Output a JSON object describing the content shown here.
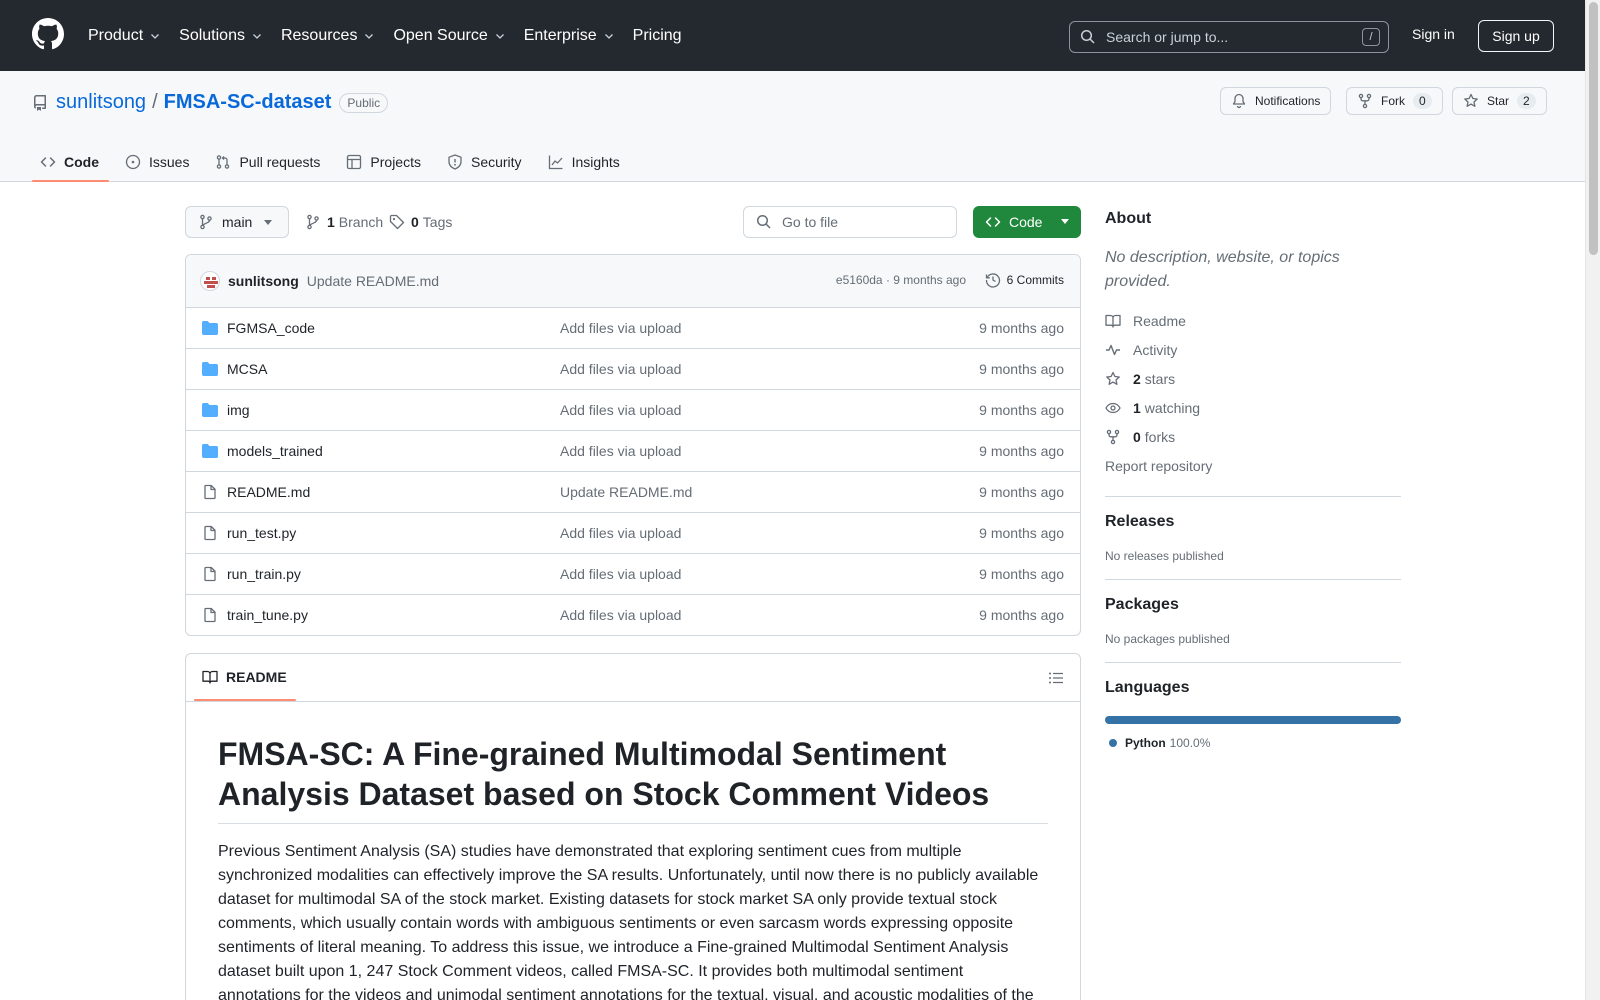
{
  "topnav": {
    "menu": [
      {
        "label": "Product",
        "has_dropdown": true
      },
      {
        "label": "Solutions",
        "has_dropdown": true
      },
      {
        "label": "Resources",
        "has_dropdown": true
      },
      {
        "label": "Open Source",
        "has_dropdown": true
      },
      {
        "label": "Enterprise",
        "has_dropdown": true
      },
      {
        "label": "Pricing",
        "has_dropdown": false
      }
    ],
    "search_placeholder": "Search or jump to...",
    "search_shortcut": "/",
    "signin": "Sign in",
    "signup": "Sign up"
  },
  "repo": {
    "owner": "sunlitsong",
    "separator": "/",
    "name": "FMSA-SC-dataset",
    "visibility": "Public",
    "notifications_label": "Notifications",
    "fork_label": "Fork",
    "fork_count": "0",
    "star_label": "Star",
    "star_count": "2"
  },
  "tabs": [
    {
      "label": "Code",
      "icon": "code-icon",
      "active": true
    },
    {
      "label": "Issues",
      "icon": "issue-icon",
      "active": false
    },
    {
      "label": "Pull requests",
      "icon": "pull-request-icon",
      "active": false
    },
    {
      "label": "Projects",
      "icon": "table-icon",
      "active": false
    },
    {
      "label": "Security",
      "icon": "shield-icon",
      "active": false
    },
    {
      "label": "Insights",
      "icon": "graph-icon",
      "active": false
    }
  ],
  "toolbar": {
    "branch": "main",
    "branch_count": "1",
    "branch_label": "Branch",
    "tag_count": "0",
    "tag_label": "Tags",
    "goto_placeholder": "Go to file",
    "code_button": "Code"
  },
  "latest_commit": {
    "author": "sunlitsong",
    "message": "Update README.md",
    "meta": "e5160da · 9 months ago",
    "commits_label": "6 Commits"
  },
  "files": [
    {
      "type": "folder",
      "name": "FGMSA_code",
      "message": "Add files via upload",
      "age": "9 months ago"
    },
    {
      "type": "folder",
      "name": "MCSA",
      "message": "Add files via upload",
      "age": "9 months ago"
    },
    {
      "type": "folder",
      "name": "img",
      "message": "Add files via upload",
      "age": "9 months ago"
    },
    {
      "type": "folder",
      "name": "models_trained",
      "message": "Add files via upload",
      "age": "9 months ago"
    },
    {
      "type": "file",
      "name": "README.md",
      "message": "Update README.md",
      "age": "9 months ago"
    },
    {
      "type": "file",
      "name": "run_test.py",
      "message": "Add files via upload",
      "age": "9 months ago"
    },
    {
      "type": "file",
      "name": "run_train.py",
      "message": "Add files via upload",
      "age": "9 months ago"
    },
    {
      "type": "file",
      "name": "train_tune.py",
      "message": "Add files via upload",
      "age": "9 months ago"
    }
  ],
  "readme": {
    "tab_label": "README",
    "title": "FMSA-SC: A Fine-grained Multimodal Sentiment Analysis Dataset based on Stock Comment Videos",
    "paragraph": "Previous Sentiment Analysis (SA) studies have demonstrated that exploring sentiment cues from multiple synchronized modalities can effectively improve the SA results. Unfortunately, until now there is no publicly available dataset for multimodal SA of the stock market. Existing datasets for stock market SA only provide textual stock comments, which usually contain words with ambiguous sentiments or even sarcasm words expressing opposite sentiments of literal meaning. To address this issue, we introduce a Fine-grained Multimodal Sentiment Analysis dataset built upon 1, 247 Stock Comment videos, called FMSA-SC. It provides both multimodal sentiment annotations for the videos and unimodal sentiment annotations for the textual, visual, and acoustic modalities of the"
  },
  "sidebar": {
    "about_title": "About",
    "about_desc": "No description, website, or topics provided.",
    "items": [
      {
        "icon": "book-icon",
        "count": "",
        "label": "Readme"
      },
      {
        "icon": "pulse-icon",
        "count": "",
        "label": "Activity"
      },
      {
        "icon": "star-icon",
        "count": "2",
        "label": "stars"
      },
      {
        "icon": "eye-icon",
        "count": "1",
        "label": "watching"
      },
      {
        "icon": "fork-icon",
        "count": "0",
        "label": "forks"
      }
    ],
    "report": "Report repository",
    "releases_title": "Releases",
    "releases_text": "No releases published",
    "packages_title": "Packages",
    "packages_text": "No packages published",
    "languages_title": "Languages",
    "language": {
      "name": "Python",
      "percent": "100.0%",
      "color": "#3572A5"
    }
  },
  "colors": {
    "header_bg": "#24292f",
    "link": "#0969da",
    "primary_button": "#1f883d",
    "active_tab_underline": "#fd8c73"
  }
}
